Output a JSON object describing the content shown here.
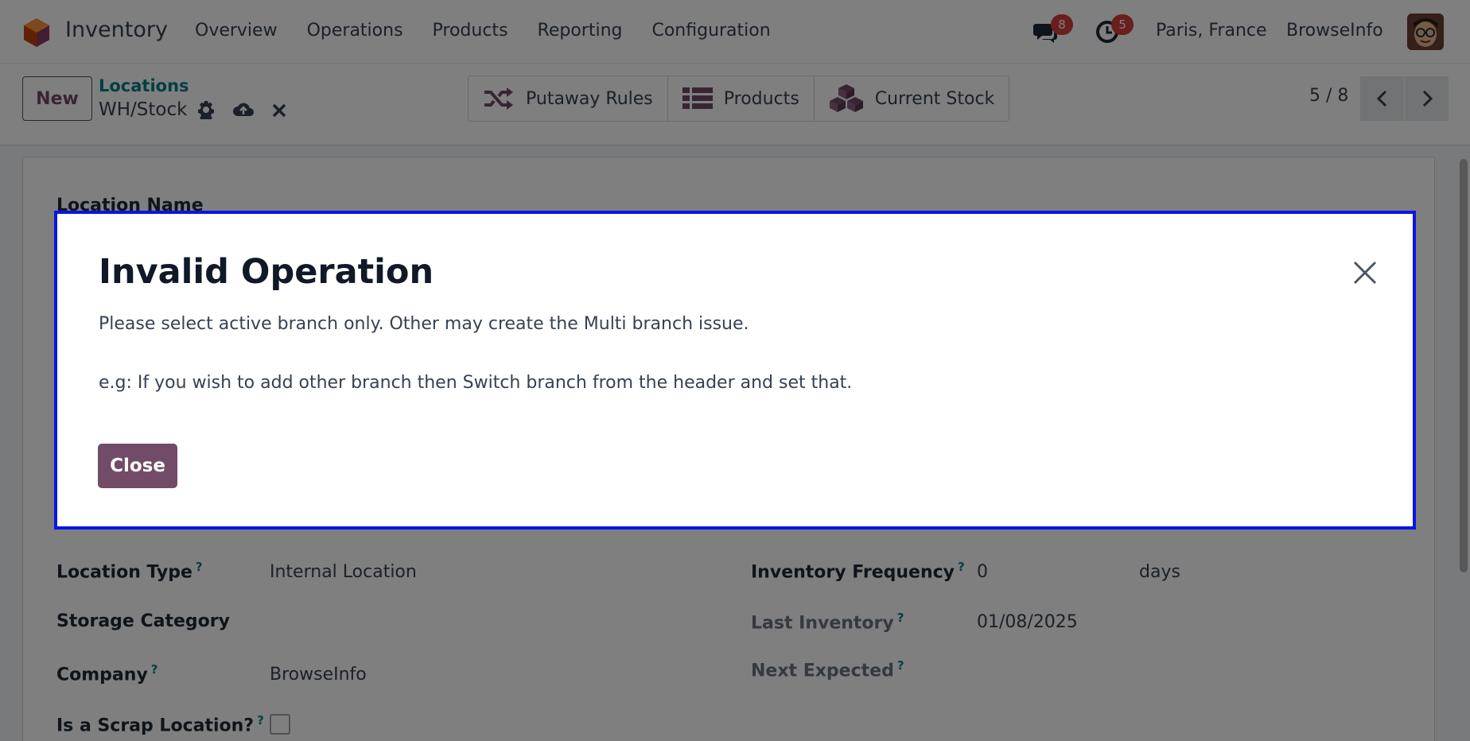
{
  "navbar": {
    "app_name": "Inventory",
    "menu": [
      "Overview",
      "Operations",
      "Products",
      "Reporting",
      "Configuration"
    ],
    "messages_count": "8",
    "activities_count": "5",
    "location": "Paris, France",
    "company": "BrowseInfo"
  },
  "control": {
    "new_label": "New",
    "breadcrumb": "Locations",
    "record_name": "WH/Stock",
    "smart_buttons": [
      "Putaway Rules",
      "Products",
      "Current Stock"
    ],
    "pager": "5 / 8"
  },
  "form": {
    "location_name_label": "Location Name",
    "location_type_label": "Location Type",
    "location_type_value": "Internal Location",
    "storage_category_label": "Storage Category",
    "company_label": "Company",
    "company_value": "BrowseInfo",
    "scrap_label": "Is a Scrap Location?",
    "inventory_frequency_label": "Inventory Frequency",
    "inventory_frequency_value": "0",
    "inventory_frequency_unit": "days",
    "last_inventory_label": "Last Inventory",
    "last_inventory_value": "01/08/2025",
    "next_expected_label": "Next Expected",
    "help_marker": "?"
  },
  "dialog": {
    "title": "Invalid Operation",
    "message_line1": "Please select active branch only. Other may create the Multi branch issue.",
    "message_line2": "e.g: If you wish to add other branch then Switch branch from the header and set that.",
    "close_label": "Close"
  },
  "colors": {
    "brand": "#714b67",
    "link": "#017e84",
    "badge": "#d23f3a",
    "dialog_border": "#0a14e6"
  }
}
